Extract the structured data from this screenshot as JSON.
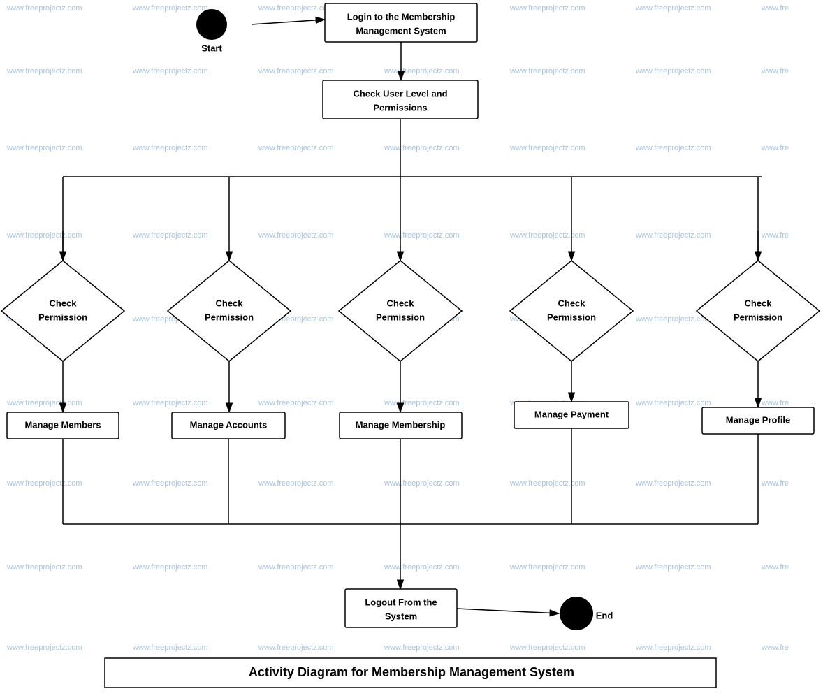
{
  "diagram": {
    "title": "Activity Diagram for Membership Management System",
    "nodes": {
      "start_label": "Start",
      "login": "Login to the Membership\nManagement System",
      "check_user": "Check User Level and\nPermissions",
      "check_perm1": "Check\nPermission",
      "check_perm2": "Check\nPermission",
      "check_perm3": "Check\nPermission",
      "check_perm4": "Check\nPermission",
      "check_perm5": "Check\nPermission",
      "manage_members": "Manage Members",
      "manage_accounts": "Manage Accounts",
      "manage_membership": "Manage Membership",
      "manage_payment": "Manage Payment",
      "manage_profile": "Manage Profile",
      "logout": "Logout From the\nSystem",
      "end_label": "End"
    },
    "watermarks": [
      "www.freeprojectz.com"
    ]
  }
}
